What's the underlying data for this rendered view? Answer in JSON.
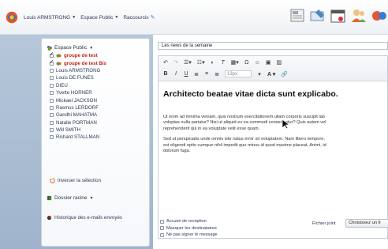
{
  "topbar": {
    "user_menu": "Louis ARMSTRONG",
    "space_menu": "Espace Public",
    "shortcuts_label": "Raccourcis"
  },
  "sidebar": {
    "group_title": "Espace Public",
    "items": [
      {
        "label": "groupe de test",
        "checked": true,
        "highlight": true
      },
      {
        "label": "groupe de test Bis",
        "checked": true,
        "highlight": true
      },
      {
        "label": "Louis ARMSTRONG",
        "checked": false,
        "highlight": false
      },
      {
        "label": "Louis DE FUNES",
        "checked": false,
        "highlight": false
      },
      {
        "label": "DIEU",
        "checked": false,
        "highlight": false
      },
      {
        "label": "Yvette HORNER",
        "checked": false,
        "highlight": false
      },
      {
        "label": "Mickael JACKSON",
        "checked": false,
        "highlight": false
      },
      {
        "label": "Rasmus LERDORF",
        "checked": false,
        "highlight": false
      },
      {
        "label": "Gandhi MAHATMA",
        "checked": false,
        "highlight": false
      },
      {
        "label": "Natalie PORTMAN",
        "checked": false,
        "highlight": false
      },
      {
        "label": "Will SMITH",
        "checked": false,
        "highlight": false
      },
      {
        "label": "Richard STALLMAN",
        "checked": false,
        "highlight": false
      }
    ],
    "invert_label": "Inverser la sélection",
    "folder_label": "Dossier racine",
    "history_label": "Historique des e-mails envoyés"
  },
  "editor": {
    "subject_value": "Les news de la semaine",
    "font_size": "13px",
    "heading": "Architecto beatae vitae dicta sunt explicabo.",
    "para1_lines": [
      "Ut enim ad minima veniam, quis nostrum exercitationem ullam corporis suscipit lab",
      "voluptas nulla pariatur? Nisi ut aliquid ex ea commodi consequatur? Quis autem vel",
      "reprehenderit qui in ea voluptate velit esse quam."
    ],
    "para2_lines": [
      "Sed ut perspiciatis unde omnis iste natus error sit voluptatem. Nam libero tempore,",
      "est eligendi optio cumque nihil impedit quo minus id quod maxime placeat. Animi, id",
      "dolorum fuga."
    ]
  },
  "options": {
    "receipt": "Accusé de reception",
    "hide_recipients": "Masquer les destinataires",
    "no_sign": "Ne pas signer le message"
  },
  "attachment": {
    "label": "Fichier joint",
    "button": "Choisissez un fi"
  },
  "colors": {
    "sidebar_bg": "#a9bdd3",
    "accent_red": "#c0261f",
    "text_blue": "#2b3a55"
  }
}
